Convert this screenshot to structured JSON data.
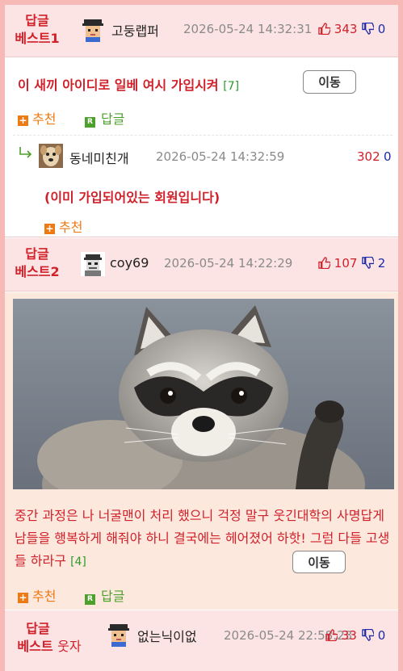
{
  "posts": [
    {
      "label": "답글",
      "rank": "베스트1",
      "nickname": "고둥랩퍼",
      "date": "2026-05-24 14:32:31",
      "upvotes": "343",
      "downvotes": "0",
      "title": "이 새끼 아이디로 일베 여시 가입시켜",
      "reply_count": "[7]",
      "move_label": "이동",
      "recommend_label": "추천",
      "reply_label": "답글",
      "comment": {
        "nickname": "동네미친개",
        "date": "2026-05-24 14:32:59",
        "upvotes": "302",
        "downvotes": "0",
        "text": "(이미 가입되어있는 회원입니다)",
        "recommend_label": "추천"
      }
    },
    {
      "label": "답글",
      "rank": "베스트2",
      "nickname": "coy69",
      "date": "2026-05-24 14:22:29",
      "upvotes": "107",
      "downvotes": "2",
      "text": "중간 과정은 나 너굴맨이 처리 했으니 걱정 말구 웃긴대학의 사명답게 남들을 행복하게 해줘야 하니 결국에는 헤어졌어 하핫! 그럼 다들 고생들 하라구",
      "reply_count": "[4]",
      "move_label": "이동",
      "recommend_label": "추천",
      "reply_label": "답글",
      "image_alt": "raccoon-waving-photo"
    },
    {
      "label": "답글",
      "rank": "베스트",
      "rank_suffix": "웃자",
      "nickname": "없는닉이없",
      "date": "2026-05-24 22:58:23",
      "upvotes": "33",
      "downvotes": "0"
    }
  ],
  "colors": {
    "border": "#f6b9b6",
    "best_header_bg": "#fde4e4",
    "best2_body_bg": "#fde8de",
    "accent_red": "#d0202a",
    "down_blue": "#1a2aa8",
    "recommend_orange": "#ee7a14",
    "reply_green": "#4da02b"
  },
  "icons": [
    "thumb-up-icon",
    "thumb-down-icon",
    "reply-arrow-icon",
    "plus-icon",
    "reply-r-icon"
  ]
}
